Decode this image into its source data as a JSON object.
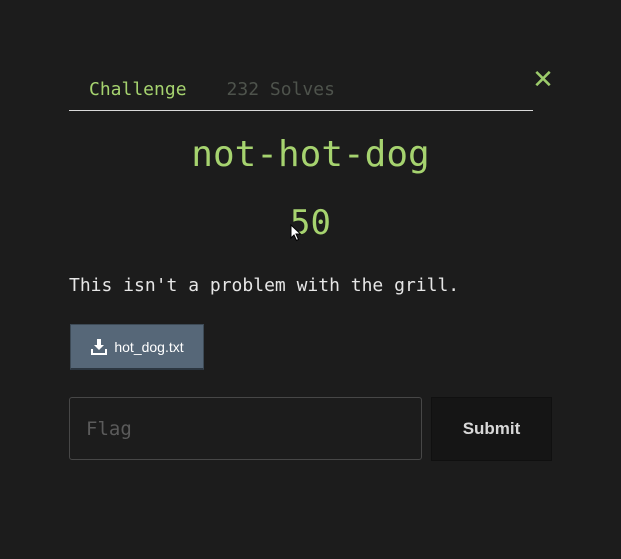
{
  "modal": {
    "close_icon": "close-icon",
    "close_glyph": "✕"
  },
  "tabs": [
    {
      "label": "Challenge",
      "active": true
    },
    {
      "label": "232 Solves",
      "active": false
    }
  ],
  "challenge": {
    "name": "not-hot-dog",
    "value": "50",
    "description": "This isn't a problem with the grill."
  },
  "file": {
    "icon": "download-icon",
    "label": "hot_dog.txt"
  },
  "form": {
    "flag_placeholder": "Flag",
    "flag_value": "",
    "submit_label": "Submit"
  },
  "colors": {
    "background": "#1c1c1c",
    "accent": "#a6d36f",
    "file_button": "#566778"
  }
}
